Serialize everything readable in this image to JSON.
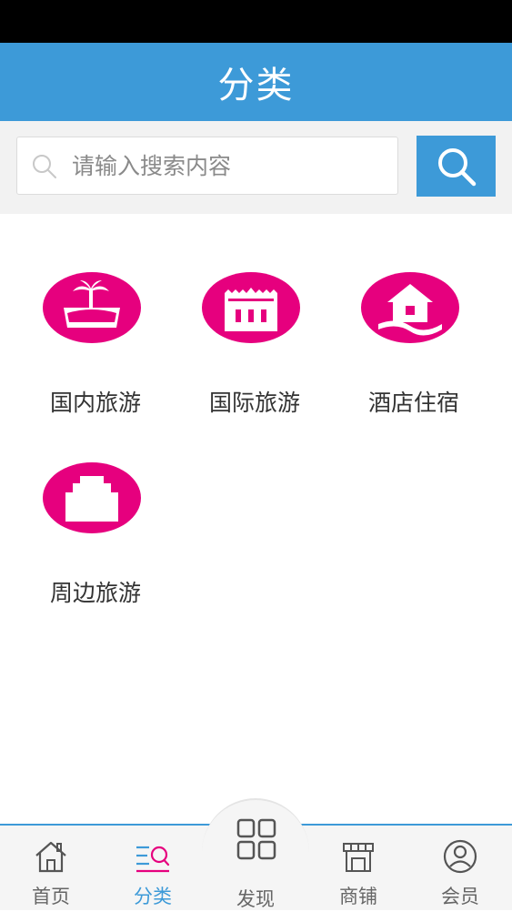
{
  "header": {
    "title": "分类"
  },
  "search": {
    "placeholder": "请输入搜索内容",
    "value": ""
  },
  "categories": [
    {
      "label": "国内旅游",
      "icon": "tropical-island-icon"
    },
    {
      "label": "国际旅游",
      "icon": "castle-icon"
    },
    {
      "label": "酒店住宿",
      "icon": "house-icon"
    },
    {
      "label": "周边旅游",
      "icon": "building-icon"
    }
  ],
  "tabs": [
    {
      "label": "首页",
      "icon": "home-icon",
      "active": false
    },
    {
      "label": "分类",
      "icon": "category-search-icon",
      "active": true
    },
    {
      "label": "发现",
      "icon": "grid-icon",
      "active": false
    },
    {
      "label": "商铺",
      "icon": "store-icon",
      "active": false
    },
    {
      "label": "会员",
      "icon": "user-icon",
      "active": false
    }
  ],
  "colors": {
    "brand_blue": "#3d9ad8",
    "icon_magenta": "#e6007e",
    "status_bar": "#000000"
  }
}
